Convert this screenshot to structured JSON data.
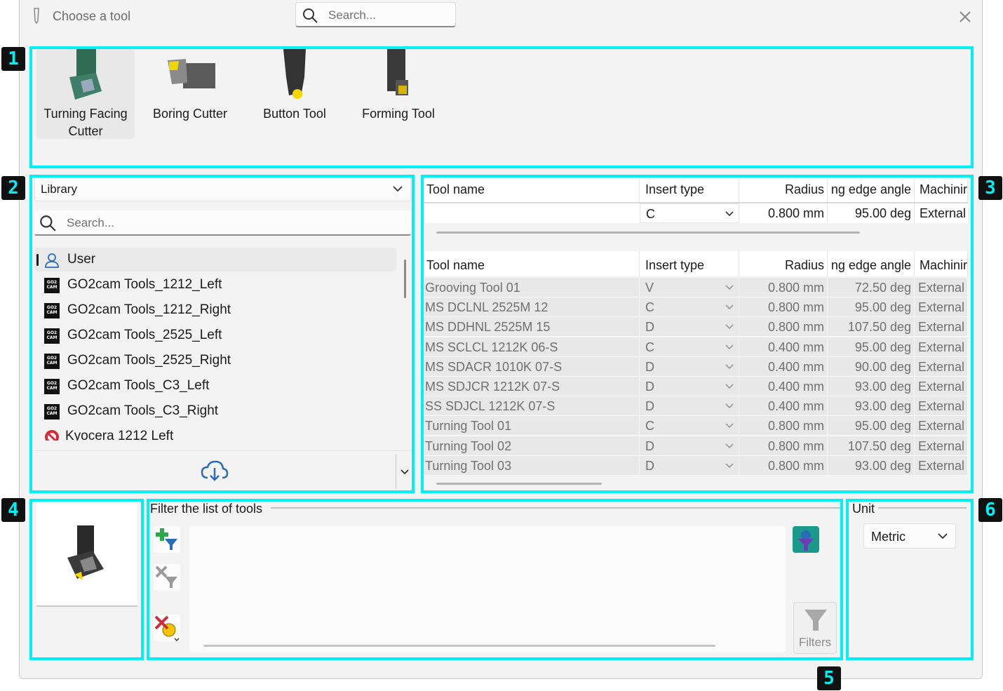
{
  "window": {
    "title": "Choose a tool",
    "search_placeholder": "Search..."
  },
  "badges": [
    "1",
    "2",
    "3",
    "4",
    "5",
    "6"
  ],
  "tool_types": [
    {
      "label": "Turning Facing Cutter",
      "line1": "Turning Facing",
      "line2": "Cutter",
      "selected": true
    },
    {
      "label": "Boring Cutter"
    },
    {
      "label": "Button Tool"
    },
    {
      "label": "Forming Tool"
    }
  ],
  "library": {
    "dropdown_label": "Library",
    "search_placeholder": "Search...",
    "items": [
      {
        "label": "User",
        "icon": "user-icon",
        "selected": true
      },
      {
        "label": "GO2cam Tools_1212_Left",
        "icon": "go2cam-icon"
      },
      {
        "label": "GO2cam Tools_1212_Right",
        "icon": "go2cam-icon"
      },
      {
        "label": "GO2cam Tools_2525_Left",
        "icon": "go2cam-icon"
      },
      {
        "label": "GO2cam Tools_2525_Right",
        "icon": "go2cam-icon"
      },
      {
        "label": "GO2cam Tools_C3_Left",
        "icon": "go2cam-icon"
      },
      {
        "label": "GO2cam Tools_C3_Right",
        "icon": "go2cam-icon"
      },
      {
        "label": "Kyocera 1212 Left",
        "icon": "kyocera-icon"
      }
    ]
  },
  "tool_table": {
    "columns": [
      "Tool name",
      "Insert type",
      "Radius",
      "ng edge angle",
      "Machinir"
    ],
    "edit_row": {
      "name": "",
      "insert": "C",
      "radius": "0.800 mm",
      "angle": "95.00 deg",
      "machining": "External"
    },
    "rows": [
      {
        "name": "Grooving Tool 01",
        "insert": "V",
        "radius": "0.800 mm",
        "angle": "72.50 deg",
        "machining": "External"
      },
      {
        "name": "MS DCLNL 2525M 12",
        "insert": "C",
        "radius": "0.800 mm",
        "angle": "95.00 deg",
        "machining": "External"
      },
      {
        "name": "MS DDHNL 2525M 15",
        "insert": "D",
        "radius": "0.800 mm",
        "angle": "107.50 deg",
        "machining": "External"
      },
      {
        "name": "MS SCLCL 1212K 06-S",
        "insert": "C",
        "radius": "0.400 mm",
        "angle": "95.00 deg",
        "machining": "External"
      },
      {
        "name": "MS SDACR 1010K 07-S",
        "insert": "D",
        "radius": "0.400 mm",
        "angle": "90.00 deg",
        "machining": "External"
      },
      {
        "name": "MS SDJCR 1212K 07-S",
        "insert": "D",
        "radius": "0.400 mm",
        "angle": "93.00 deg",
        "machining": "External"
      },
      {
        "name": "SS SDJCL 1212K 07-S",
        "insert": "D",
        "radius": "0.400 mm",
        "angle": "93.00 deg",
        "machining": "External"
      },
      {
        "name": "Turning Tool 01",
        "insert": "C",
        "radius": "0.800 mm",
        "angle": "95.00 deg",
        "machining": "External"
      },
      {
        "name": "Turning Tool 02",
        "insert": "D",
        "radius": "0.800 mm",
        "angle": "107.50 deg",
        "machining": "External"
      },
      {
        "name": "Turning Tool 03",
        "insert": "D",
        "radius": "0.800 mm",
        "angle": "93.00 deg",
        "machining": "External"
      }
    ]
  },
  "filter": {
    "group_title": "Filter the list of tools",
    "filters_button": "Filters"
  },
  "unit": {
    "group_title": "Unit",
    "value": "Metric"
  },
  "colors": {
    "highlight": "#00f0f5",
    "badge_bg": "#111111",
    "accent_teal": "#1a9a8a"
  }
}
